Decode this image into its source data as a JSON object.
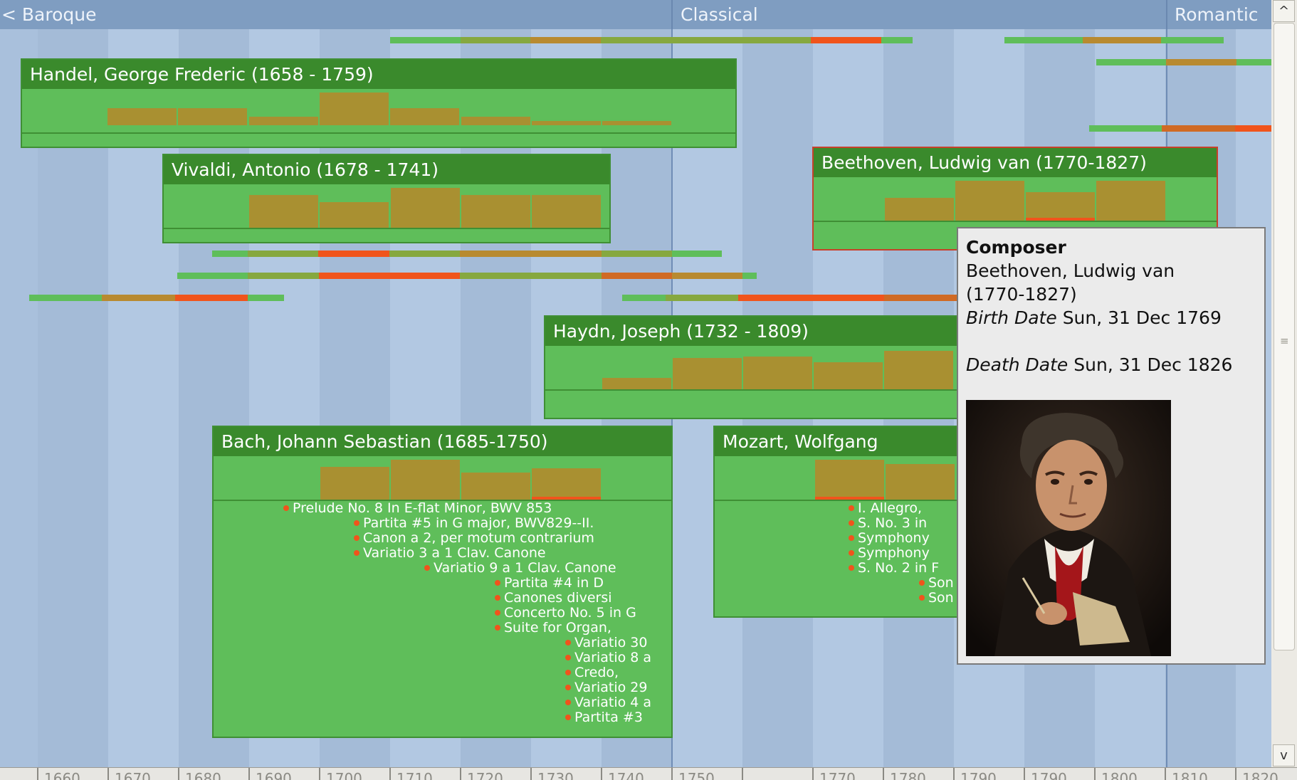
{
  "eras": {
    "baroque": "< Baroque",
    "classical": "Classical",
    "romantic": "Romantic"
  },
  "composers": {
    "handel": "Handel, George Frederic (1658 - 1759)",
    "vivaldi": "Vivaldi, Antonio (1678 - 1741)",
    "beethoven": "Beethoven, Ludwig van (1770-1827)",
    "haydn": "Haydn, Joseph (1732 - 1809)",
    "bach": "Bach, Johann Sebastian (1685-1750)",
    "mozart": "Mozart, Wolfgang"
  },
  "bach_works": [
    "Prelude No. 8 In E-flat Minor, BWV 853",
    "Partita #5 in G major, BWV829--II.",
    "Canon a 2, per motum contrarium",
    "Variatio 3 a 1 Clav. Canone",
    "Variatio 9 a 1 Clav. Canone",
    "Partita #4 in D",
    "Canones diversi",
    "Concerto No. 5 in G",
    "Suite for Organ,",
    "Variatio 30",
    "Variatio 8 a",
    "Credo,",
    "Variatio 29",
    "Variatio 4 a",
    "Partita #3"
  ],
  "mozart_works": [
    "I. Allegro,",
    "S. No. 3 in",
    "Symphony",
    "Symphony",
    "S. No. 2 in F",
    "Son",
    "Son"
  ],
  "popup": {
    "heading": "Composer",
    "name": "Beethoven, Ludwig van",
    "lifespan": "(1770-1827)",
    "birth_label": "Birth Date",
    "birth_value": "Sun, 31 Dec 1769",
    "death_label": "Death Date",
    "death_value": "Sun, 31 Dec 1826",
    "image": "composer-portrait"
  },
  "ruler_years": [
    "1660",
    "1670",
    "1680",
    "1690",
    "1700",
    "1710",
    "1720",
    "1730",
    "1740",
    "1750",
    "",
    "1770",
    "1780",
    "1790",
    "1790",
    "1800",
    "1810",
    "1820"
  ],
  "scrollbar": {
    "up": "^",
    "down": "v",
    "grip": "≡"
  },
  "colors": {
    "activity_low": "#5fbe5a",
    "activity_mid": "#b88a30",
    "activity_high": "#f0541c",
    "card_header": "#3a8a2c",
    "card_body": "#5fbe5a",
    "histogram_bar": "#a99031"
  }
}
